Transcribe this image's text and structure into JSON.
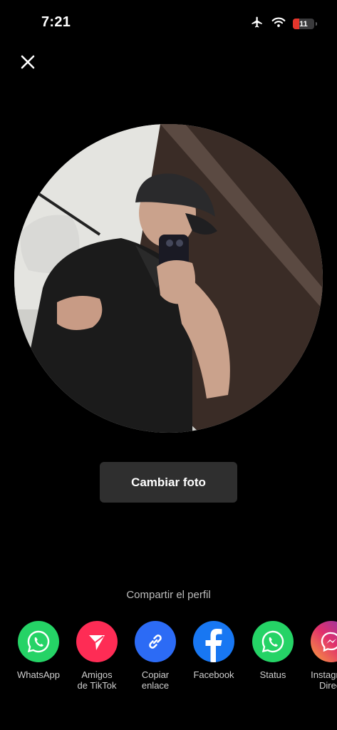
{
  "status_bar": {
    "time": "7:21",
    "battery_level": "11",
    "airplane_mode": true,
    "wifi": true
  },
  "close_button": {
    "icon": "close-icon"
  },
  "profile_photo": {
    "alt": "Foto de perfil"
  },
  "change_photo_button": {
    "label": "Cambiar foto"
  },
  "share": {
    "title": "Compartir el perfil",
    "items": [
      {
        "line1": "WhatsApp",
        "line2": "",
        "icon": "whatsapp-icon",
        "color": "#25D366"
      },
      {
        "line1": "Amigos",
        "line2": "de TikTok",
        "icon": "send-icon",
        "color": "#FE2C55"
      },
      {
        "line1": "Copiar",
        "line2": "enlace",
        "icon": "link-icon",
        "color": "#2C6BF5"
      },
      {
        "line1": "Facebook",
        "line2": "",
        "icon": "facebook-icon",
        "color": "#1877F2"
      },
      {
        "line1": "Status",
        "line2": "",
        "icon": "whatsapp-status-icon",
        "color": "#25D366"
      },
      {
        "line1": "Instagram",
        "line2": "Direct",
        "icon": "messenger-icon",
        "color": "#C13584"
      }
    ]
  }
}
